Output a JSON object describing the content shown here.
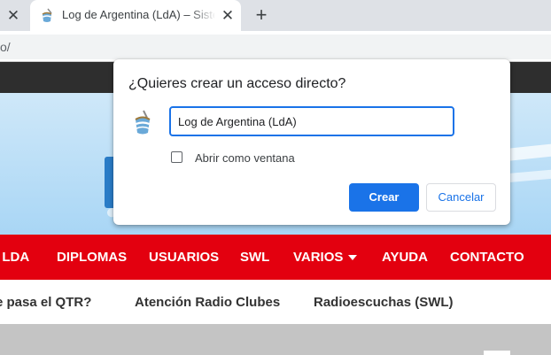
{
  "browser": {
    "prev_tab_close_glyph": "✕",
    "active_tab": {
      "title": "Log de Argentina (LdA) – Sistema",
      "close_glyph": "✕"
    },
    "new_tab_glyph": "+",
    "url_visible": "o/"
  },
  "site": {
    "menu": [
      {
        "label": "I LDA"
      },
      {
        "label": "DIPLOMAS"
      },
      {
        "label": "USUARIOS"
      },
      {
        "label": "SWL"
      },
      {
        "label": "VARIOS"
      },
      {
        "label": "AYUDA"
      },
      {
        "label": "CONTACTO"
      }
    ],
    "submenu": [
      {
        "label": "e pasa el QTR?"
      },
      {
        "label": "Atención Radio Clubes"
      },
      {
        "label": "Radioescuchas (SWL)"
      }
    ],
    "colors": {
      "menu_red": "#e3000f",
      "top_dark": "#2e2e2e",
      "banner_blue": "#a9d6f5"
    }
  },
  "dialog": {
    "title": "¿Quieres crear un acceso directo?",
    "name_value": "Log de Argentina (LdA)",
    "open_as_window_label": "Abrir como ventana",
    "open_as_window_checked": false,
    "create_label": "Crear",
    "cancel_label": "Cancelar",
    "accent_color": "#1a73e8"
  }
}
